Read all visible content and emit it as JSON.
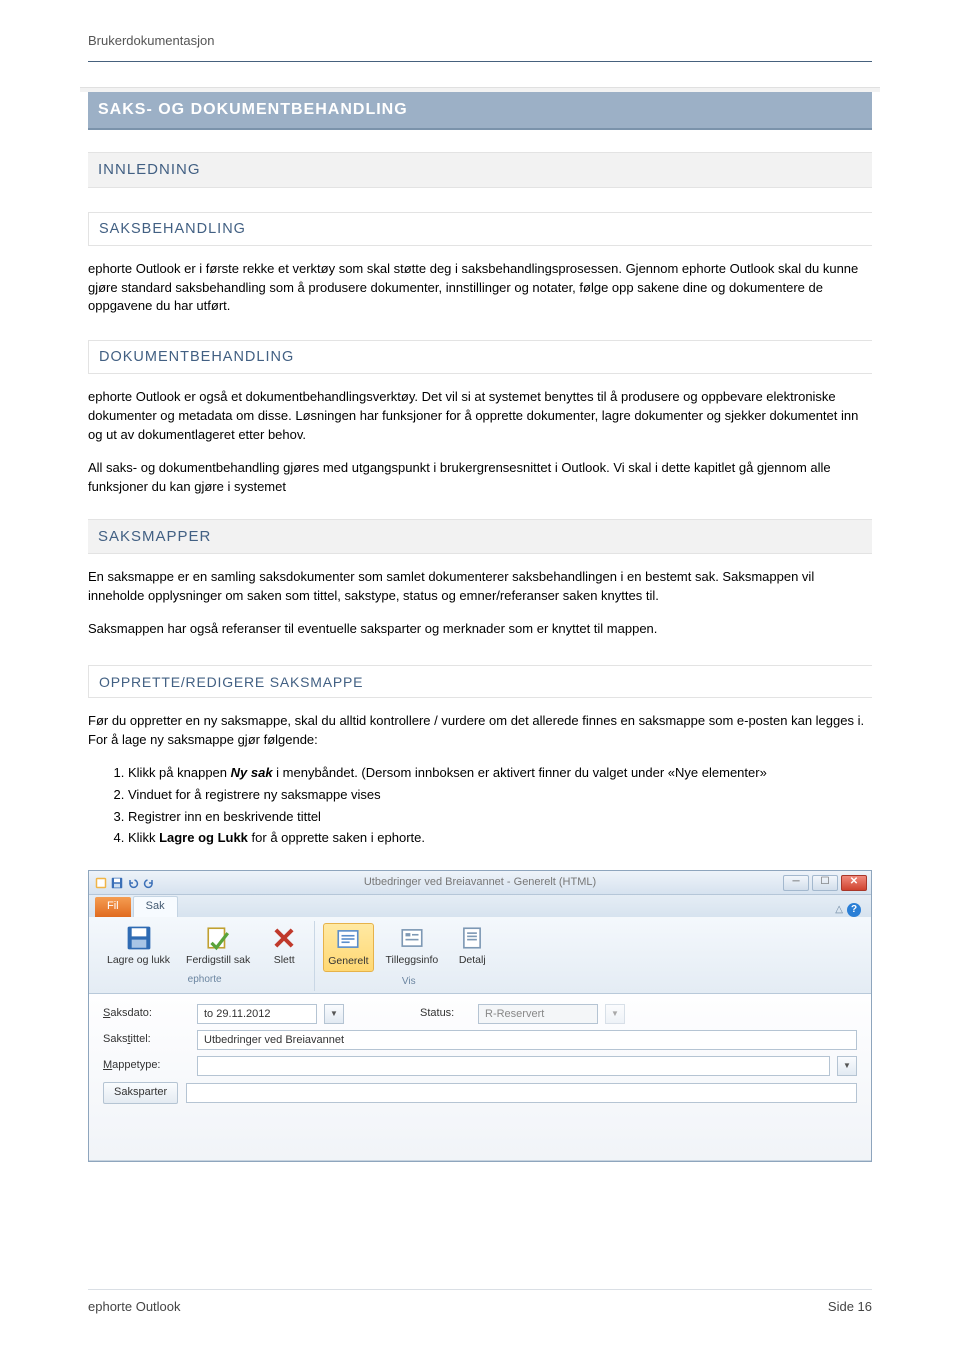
{
  "header": {
    "title": "Brukerdokumentasjon"
  },
  "h1": "SAKS- OG DOKUMENTBEHANDLING",
  "innledning": {
    "title": "INNLEDNING",
    "saksbehandling": {
      "title": "SAKSBEHANDLING",
      "p1": "ephorte Outlook er i første rekke et verktøy som skal støtte deg i saksbehandlingsprosessen. Gjennom ephorte Outlook skal du kunne gjøre standard saksbehandling som å produsere dokumenter, innstillinger og notater, følge opp sakene dine og dokumentere de oppgavene du har utført."
    },
    "dokumentbehandling": {
      "title": "DOKUMENTBEHANDLING",
      "p1": "ephorte Outlook er også et dokumentbehandlingsverktøy. Det vil si at systemet benyttes til å produsere og oppbevare elektroniske dokumenter og metadata om disse. Løsningen har funksjoner for å opprette dokumenter, lagre dokumenter og sjekker dokumentet inn og ut av dokumentlageret etter behov.",
      "p2": "All saks- og dokumentbehandling gjøres med utgangspunkt i brukergrensesnittet i Outlook. Vi skal i dette kapitlet gå gjennom alle funksjoner du kan gjøre i systemet"
    }
  },
  "saksmapper": {
    "title": "SAKSMAPPER",
    "p1": "En saksmappe er en samling saksdokumenter som samlet dokumenterer saksbehandlingen i en bestemt sak. Saksmappen vil inneholde opplysninger om saken som tittel, sakstype, status og emner/referanser saken knyttes til.",
    "p2": "Saksmappen har også referanser til eventuelle saksparter og merknader som er knyttet til mappen."
  },
  "opprette": {
    "title": "OPPRETTE/REDIGERE SAKSMAPPE",
    "intro": "Før du oppretter en ny saksmappe, skal du alltid kontrollere / vurdere om det allerede finnes en saksmappe som e-posten kan legges i. For å lage ny saksmappe gjør følgende:",
    "steps": {
      "s1a": "Klikk på knappen ",
      "s1b": "Ny sak",
      "s1c": " i menybåndet. (Dersom innboksen er aktivert finner du valget under «Nye elementer»",
      "s2": "Vinduet for å registrere ny saksmappe vises",
      "s3": "Registrer inn en beskrivende tittel",
      "s4a": "Klikk ",
      "s4b": "Lagre og Lukk",
      "s4c": " for å opprette saken i ephorte."
    }
  },
  "window": {
    "title": "Utbedringer ved Breiavannet - Generelt (HTML)",
    "tabs": {
      "file": "Fil",
      "sak": "Sak"
    },
    "ribbon": {
      "group_ephorte": "ephorte",
      "group_vis": "Vis",
      "btn_lagre": "Lagre og lukk",
      "btn_ferdigstill": "Ferdigstill sak",
      "btn_slett": "Slett",
      "btn_generelt": "Generelt",
      "btn_tillegg": "Tilleggsinfo",
      "btn_detalj": "Detalj"
    },
    "form": {
      "saksdato_label": "Saksdato:",
      "saksdato_value": "to 29.11.2012",
      "status_label": "Status:",
      "status_value": "R-Reservert",
      "sakstittel_label": "Sakstittel:",
      "sakstittel_value": "Utbedringer ved Breiavannet",
      "mappetype_label": "Mappetype:",
      "saksparter_label": "Saksparter"
    }
  },
  "footer": {
    "left": "ephorte Outlook",
    "right": "Side 16"
  }
}
